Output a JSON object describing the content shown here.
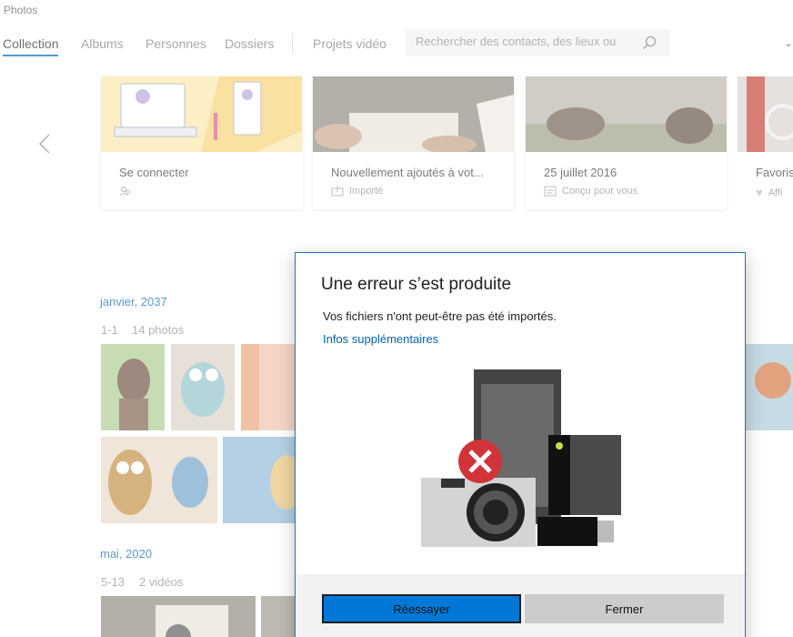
{
  "app": {
    "title": "Photos"
  },
  "nav": {
    "tabs": [
      {
        "label": "Collection",
        "active": true
      },
      {
        "label": "Albums",
        "active": false
      },
      {
        "label": "Personnes",
        "active": false
      },
      {
        "label": "Dossiers",
        "active": false
      },
      {
        "label": "Projets vidéo",
        "active": false
      }
    ],
    "search_placeholder": "Rechercher des contacts, des lieux ou"
  },
  "cards": [
    {
      "title": "Se connecter",
      "subtitle": "",
      "icon": "people-icon"
    },
    {
      "title": "Nouvellement ajoutés à vot...",
      "subtitle": "Importé",
      "icon": "import-icon"
    },
    {
      "title": "25 juillet 2016",
      "subtitle": "Conçu pour vous",
      "icon": "album-icon"
    },
    {
      "title": "Favoris",
      "subtitle": "Affi",
      "icon": "heart-icon"
    }
  ],
  "groups": [
    {
      "date": "janvier, 2037",
      "range": "1-1",
      "count": "14 photos"
    },
    {
      "date": "mai, 2020",
      "range": "5-13",
      "count": "2 vidéos"
    }
  ],
  "dialog": {
    "title": "Une erreur s’est produite",
    "message": "Vos fichiers n'ont peut-être pas été importés.",
    "link": "Infos supplémentaires",
    "retry_label": "Réessayer",
    "close_label": "Fermer"
  },
  "colors": {
    "accent": "#0063b1",
    "primary_button": "#0078d7",
    "error": "#d13438"
  }
}
